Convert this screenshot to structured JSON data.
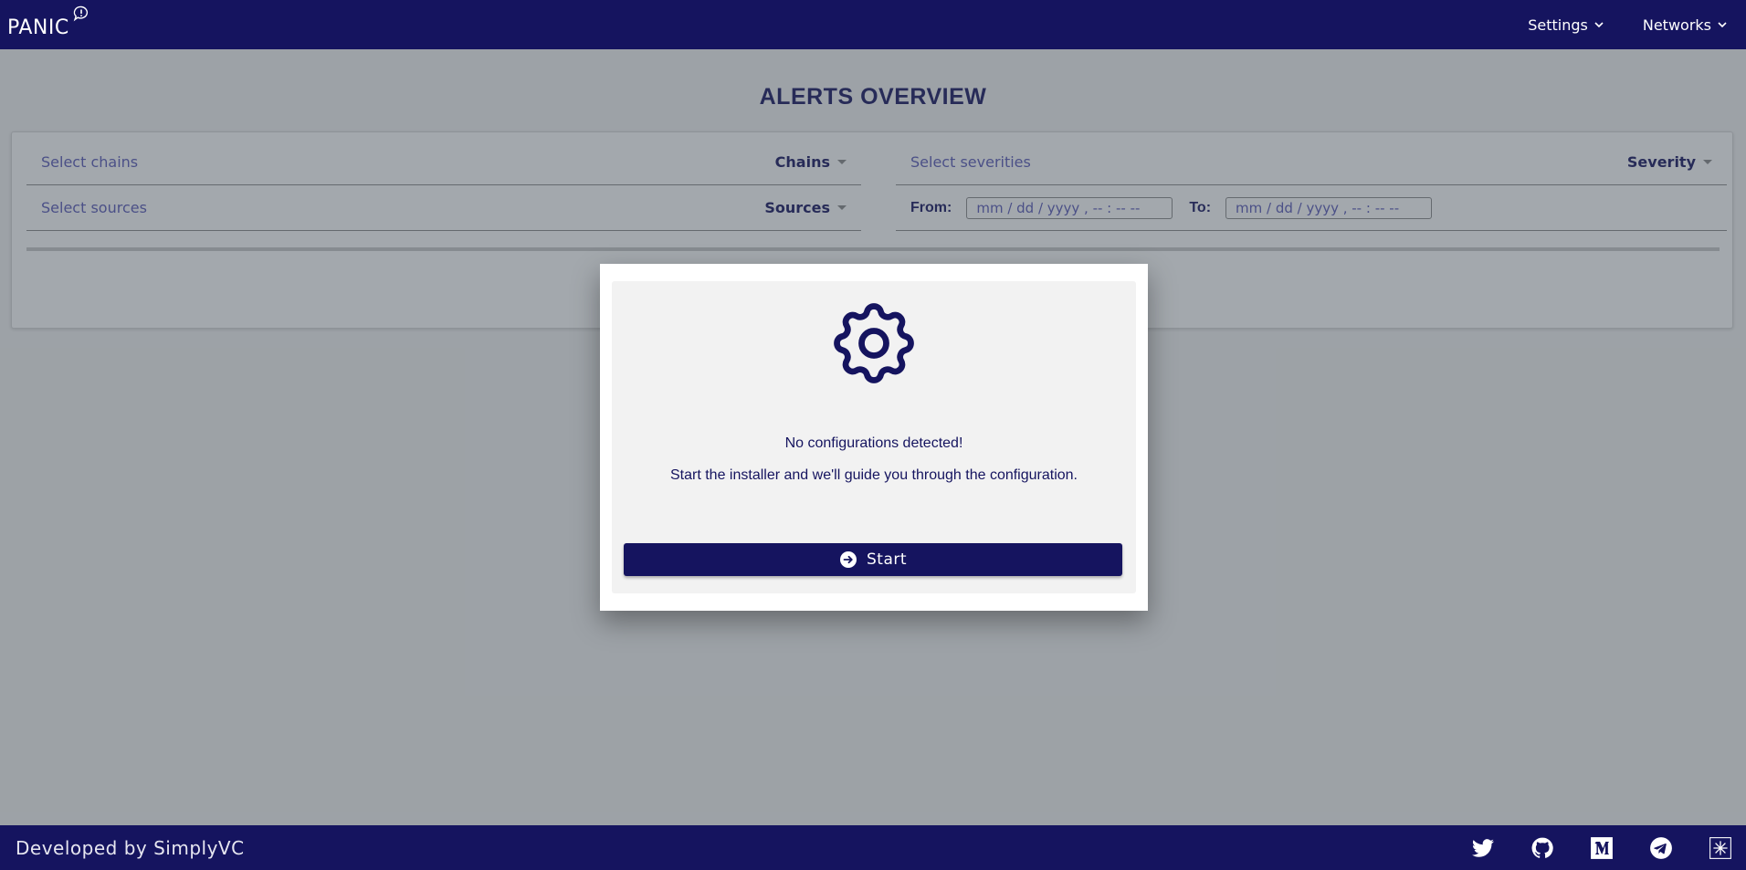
{
  "navbar": {
    "logo": "PANIC",
    "menu": [
      {
        "label": "Settings"
      },
      {
        "label": "Networks"
      }
    ]
  },
  "page": {
    "title": "ALERTS OVERVIEW"
  },
  "filters": {
    "chains": {
      "placeholder": "Select chains",
      "label": "Chains"
    },
    "severity": {
      "placeholder": "Select severities",
      "label": "Severity"
    },
    "sources": {
      "placeholder": "Select sources",
      "label": "Sources"
    },
    "from": {
      "label": "From:",
      "value": "mm / dd / yyyy ,  -- : --   --"
    },
    "to": {
      "label": "To:",
      "value": "mm / dd / yyyy ,  -- : --   --"
    }
  },
  "modal": {
    "icon": "gear-icon",
    "title": "No configurations detected!",
    "message": "Start the installer and we'll guide you through the configuration.",
    "start_label": "Start"
  },
  "footer": {
    "text": "Developed by SimplyVC",
    "social": [
      "twitter-icon",
      "github-icon",
      "medium-icon",
      "telegram-icon",
      "simplyvc-icon"
    ]
  },
  "colors": {
    "brand": "#15145f",
    "placeholder": "#5a5ab8",
    "overlay": "rgba(60,70,80,0.47)"
  }
}
